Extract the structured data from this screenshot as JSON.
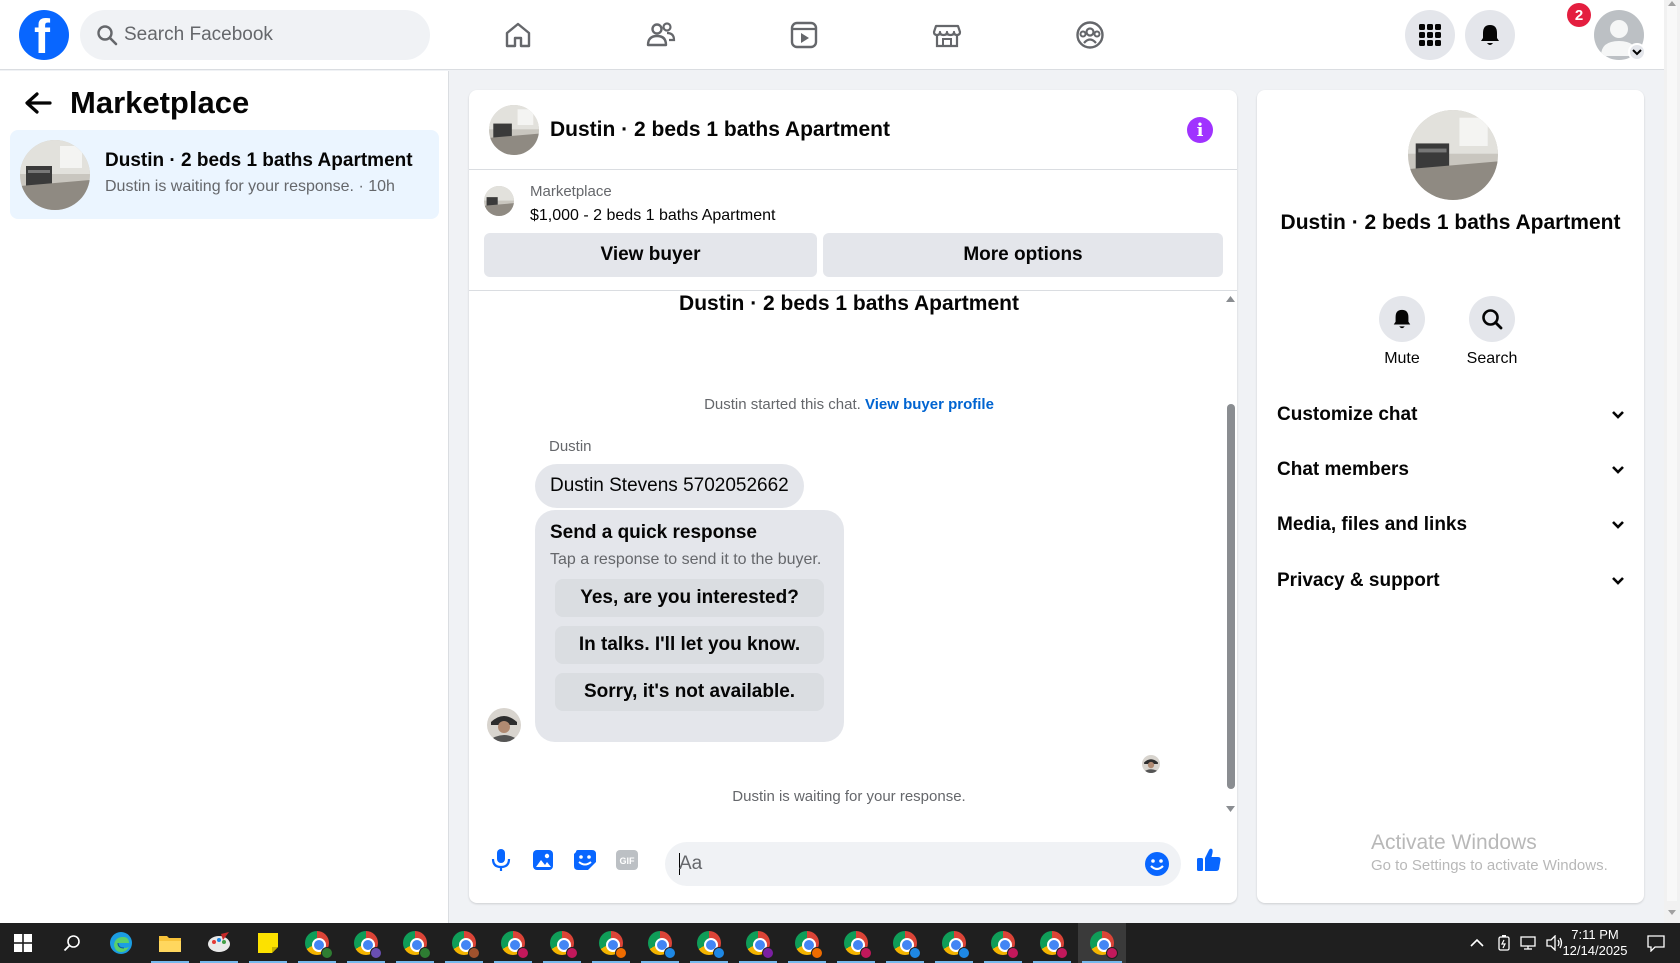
{
  "topbar": {
    "logo_letter": "f",
    "search_placeholder": "Search Facebook",
    "notification_count": "2"
  },
  "left_panel": {
    "title": "Marketplace",
    "conversation": {
      "title": "Dustin · 2 beds 1 baths Apartment",
      "subtitle": "Dustin is waiting for your response. · 10h"
    }
  },
  "chat": {
    "header_title": "Dustin · 2 beds 1 baths Apartment",
    "listing": {
      "label": "Marketplace",
      "price_line": "$1,000 - 2 beds 1 baths Apartment",
      "view_buyer": "View buyer",
      "more_options": "More options"
    },
    "thread_title": "Dustin · 2 beds 1 baths Apartment",
    "started_text": "Dustin started this chat.",
    "started_link": "View buyer profile",
    "sender_name": "Dustin",
    "message": "Dustin Stevens 5702052662",
    "quick": {
      "title": "Send a quick response",
      "subtitle": "Tap a response to send it to the buyer.",
      "options": [
        "Yes, are you interested?",
        "In talks. I'll let you know.",
        "Sorry, it's not available."
      ]
    },
    "waiting_text": "Dustin is waiting for your response.",
    "composer_placeholder": "Aa"
  },
  "right_panel": {
    "title": "Dustin · 2 beds 1 baths Apartment",
    "mute_label": "Mute",
    "search_label": "Search",
    "sections": [
      "Customize chat",
      "Chat members",
      "Media, files and links",
      "Privacy & support"
    ]
  },
  "watermark": {
    "title": "Activate Windows",
    "subtitle": "Go to Settings to activate Windows."
  },
  "taskbar": {
    "time": "7:11 PM",
    "date": "12/14/2025",
    "profile_colors": [
      "#2e7d32",
      "#6a4fb3",
      "#2e7d32",
      "#a0522d",
      "#c2185b",
      "#c2185b",
      "#ef6c00",
      "#1e88e5",
      "#1e88e5",
      "#7b1fa2",
      "#ef6c00",
      "#c2185b",
      "#1e88e5",
      "#1e88e5",
      "#c2185b",
      "#c2185b",
      "#c2185b"
    ]
  },
  "colors": {
    "brand_blue": "#0866ff",
    "link_blue": "#0064d1",
    "info_purple": "#a033ff",
    "selected_bg": "#ebf5ff"
  }
}
